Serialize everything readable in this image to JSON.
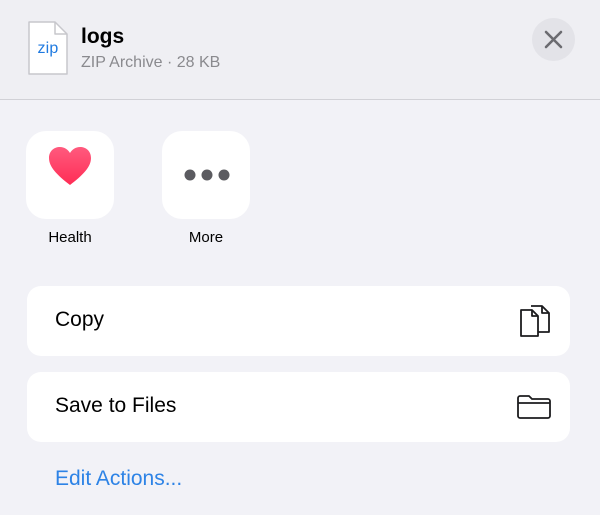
{
  "header": {
    "file_type_label": "zip",
    "file_name": "logs",
    "file_meta": "ZIP Archive · 28 KB",
    "close_icon": "close-icon"
  },
  "apps": [
    {
      "label": "Health",
      "icon": "heart-icon"
    },
    {
      "label": "More",
      "icon": "ellipsis-icon"
    }
  ],
  "actions": [
    {
      "label": "Copy",
      "icon": "copy-icon"
    },
    {
      "label": "Save to Files",
      "icon": "folder-icon"
    }
  ],
  "edit_actions_label": "Edit Actions...",
  "colors": {
    "accent": "#2d83e6",
    "heart": "#ff2d55",
    "background": "#f2f2f7"
  }
}
